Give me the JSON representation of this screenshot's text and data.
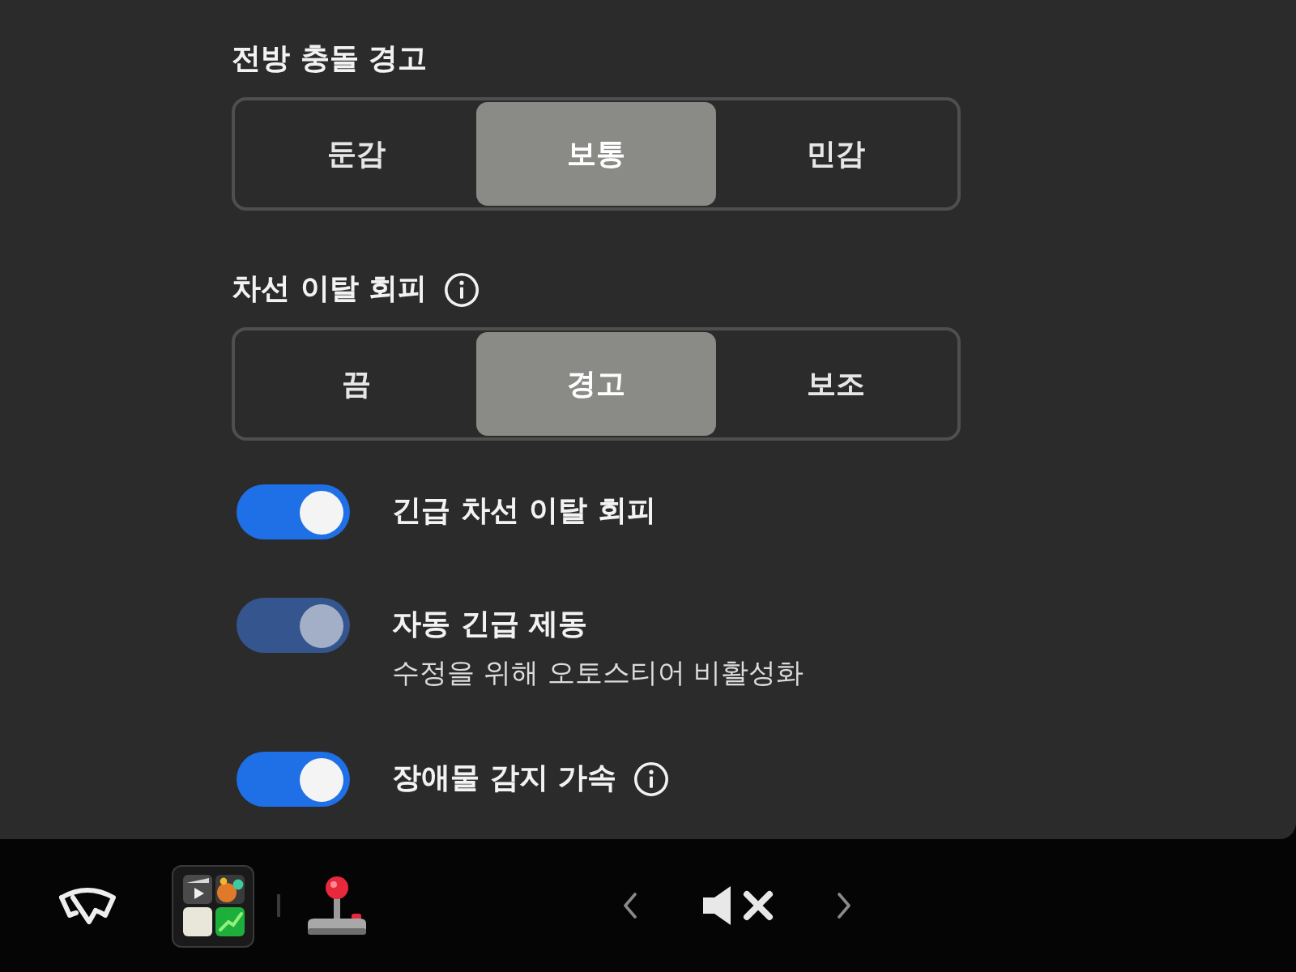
{
  "sections": [
    {
      "title": "전방 충돌 경고",
      "info": false,
      "options": [
        {
          "label": "둔감",
          "selected": false
        },
        {
          "label": "보통",
          "selected": true
        },
        {
          "label": "민감",
          "selected": false
        }
      ]
    },
    {
      "title": "차선 이탈 회피",
      "info": true,
      "options": [
        {
          "label": "끔",
          "selected": false
        },
        {
          "label": "경고",
          "selected": true
        },
        {
          "label": "보조",
          "selected": false
        }
      ]
    }
  ],
  "toggles": [
    {
      "label": "긴급 차선 이탈 회피",
      "on": true,
      "disabled": false,
      "info": false
    },
    {
      "label": "자동 긴급 제동",
      "on": true,
      "disabled": true,
      "info": false,
      "note": "수정을 위해 오토스티어 비활성화"
    },
    {
      "label": "장애물 감지 가속",
      "on": true,
      "disabled": false,
      "info": true
    }
  ],
  "volume": {
    "muted": true
  }
}
